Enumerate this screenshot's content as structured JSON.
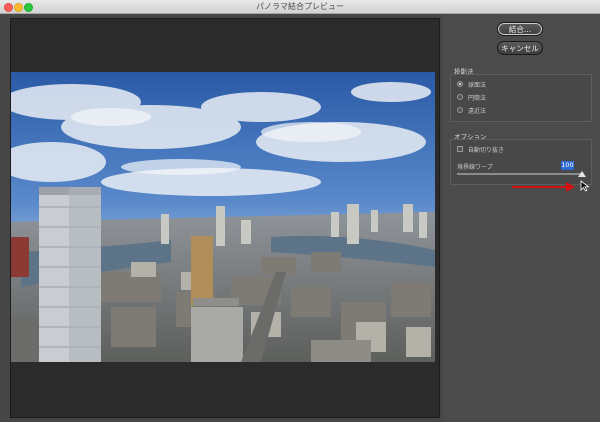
{
  "window": {
    "title": "パノラマ結合プレビュー"
  },
  "actions": {
    "merge_label": "結合...",
    "cancel_label": "キャンセル"
  },
  "projection": {
    "heading": "投影法",
    "options": [
      {
        "label": "球面法",
        "selected": true
      },
      {
        "label": "円筒法",
        "selected": false
      },
      {
        "label": "遠近法",
        "selected": false
      }
    ]
  },
  "options": {
    "heading": "オプション",
    "auto_crop": {
      "label": "自動切り抜き",
      "checked": false
    },
    "boundary_warp": {
      "label": "境界線ワープ",
      "value": "100",
      "level": 1.0
    }
  },
  "icons": [
    "close-icon",
    "minimize-icon",
    "zoom-icon",
    "cursor-icon",
    "red-arrow-annotation"
  ],
  "colors": {
    "accent_blue": "#2e6ad1",
    "annotation_red": "#d21212"
  }
}
